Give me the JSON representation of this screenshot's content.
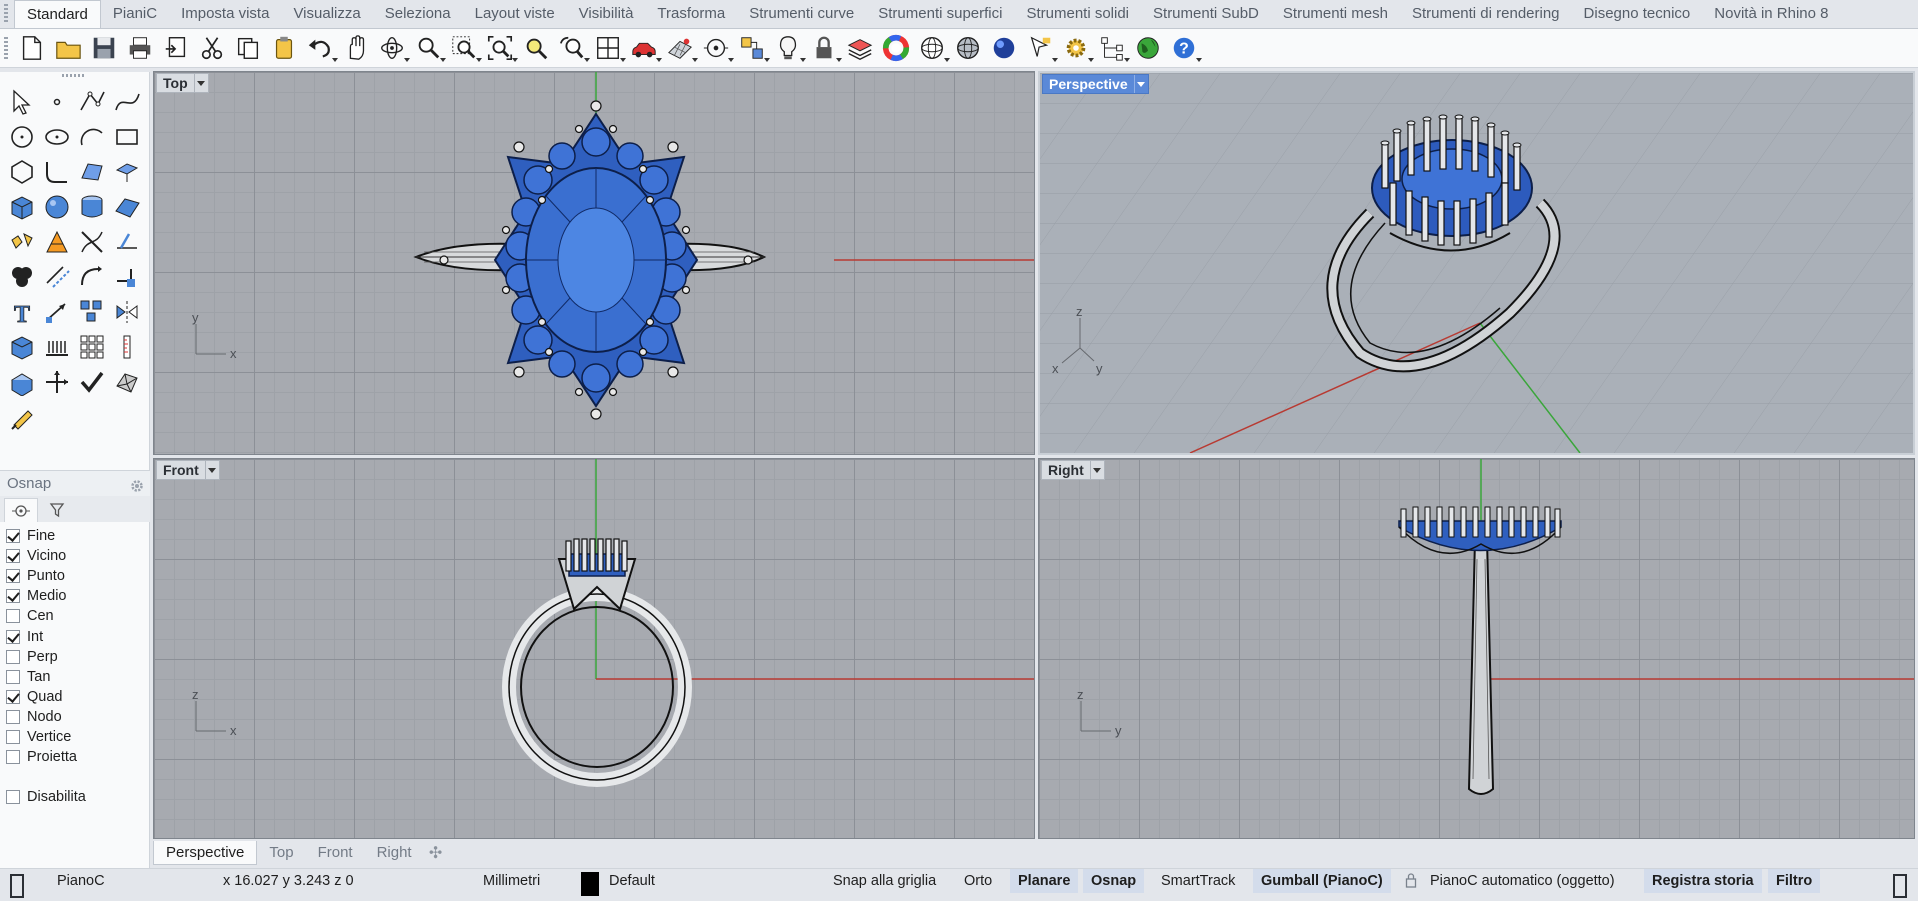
{
  "tabs": [
    "Standard",
    "PianiC",
    "Imposta vista",
    "Visualizza",
    "Seleziona",
    "Layout viste",
    "Visibilità",
    "Trasforma",
    "Strumenti curve",
    "Strumenti superfici",
    "Strumenti solidi",
    "Strumenti SubD",
    "Strumenti mesh",
    "Strumenti di rendering",
    "Disegno tecnico",
    "Novità in Rhino 8"
  ],
  "toolbar_icons": [
    "new-icon",
    "open-icon",
    "save-icon",
    "print-icon",
    "import-icon",
    "cut-icon",
    "copy-icon",
    "paste-icon",
    "undo-icon",
    "pan-hand-icon",
    "rotate-view-icon",
    "zoom-icon",
    "zoom-window-icon",
    "zoom-extents-icon",
    "zoom-selected-icon",
    "undo-view-icon",
    "four-viewports-icon",
    "car-icon",
    "planar-grid-icon",
    "circle-snap-icon",
    "filter-icon",
    "light-bulb-icon",
    "lock-icon",
    "layer-icon",
    "color-wheel-icon",
    "wireframe-sphere-icon",
    "shaded-sphere-icon",
    "render-sphere-icon",
    "pointer-flag-icon",
    "gear-icon",
    "node-tree-icon",
    "globe-icon",
    "help-icon"
  ],
  "osnap": {
    "title": "Osnap",
    "items": [
      {
        "label": "Fine",
        "checked": true
      },
      {
        "label": "Vicino",
        "checked": true
      },
      {
        "label": "Punto",
        "checked": true
      },
      {
        "label": "Medio",
        "checked": true
      },
      {
        "label": "Cen",
        "checked": false
      },
      {
        "label": "Int",
        "checked": true
      },
      {
        "label": "Perp",
        "checked": false
      },
      {
        "label": "Tan",
        "checked": false
      },
      {
        "label": "Quad",
        "checked": true
      },
      {
        "label": "Nodo",
        "checked": false
      },
      {
        "label": "Vertice",
        "checked": false
      },
      {
        "label": "Proietta",
        "checked": false
      }
    ],
    "disable": {
      "label": "Disabilita",
      "checked": false
    }
  },
  "viewports": {
    "top": {
      "label": "Top",
      "axis_a": "y",
      "axis_b": "x"
    },
    "perspective": {
      "label": "Perspective",
      "axis_z": "z",
      "axis_x": "x",
      "axis_y": "y"
    },
    "front": {
      "label": "Front",
      "axis_a": "z",
      "axis_b": "x"
    },
    "right": {
      "label": "Right",
      "axis_a": "z",
      "axis_b": "y"
    }
  },
  "viewport_tabs": [
    "Perspective",
    "Top",
    "Front",
    "Right"
  ],
  "viewport_tab_add": "✣",
  "status": {
    "plane": "PianoC",
    "coords": "x 16.027  y 3.243  z 0",
    "units": "Millimetri",
    "layer": "Default",
    "snap_grid": "Snap alla griglia",
    "orto": "Orto",
    "planare": "Planare",
    "osnap": "Osnap",
    "smarttrack": "SmartTrack",
    "gumball": "Gumball (PianoC)",
    "auto_plane": "PianoC automatico (oggetto)",
    "record_history": "Registra storia",
    "filter": "Filtro"
  },
  "colors": {
    "accent": "#5a89d8",
    "gem_blue": "#2f5fbf",
    "axis_red": "#b83a32",
    "axis_green": "#3aa63a"
  }
}
